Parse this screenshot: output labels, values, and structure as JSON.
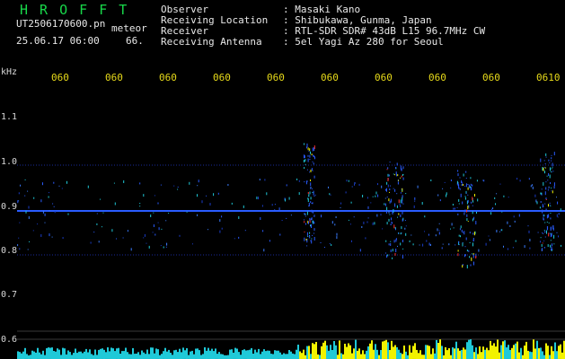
{
  "header": {
    "title": "H R O F F T",
    "filename": "UT2506170600.pn",
    "meteor_label": "meteor",
    "datetime": "25.06.17 06:00",
    "count": "66."
  },
  "info": [
    {
      "key": "Observer",
      "value": ": Masaki Kano"
    },
    {
      "key": "Receiving Location",
      "value": ": Shibukawa, Gunma, Japan"
    },
    {
      "key": "Receiver",
      "value": ": RTL-SDR SDR# 43dB L15 96.7MHz CW"
    },
    {
      "key": "Receiving Antenna",
      "value": ": 5el Yagi Az 280 for Seoul"
    }
  ],
  "axis": {
    "unit": "kHz",
    "y_labels": [
      "1.1",
      "1.0",
      "0.9",
      "0.8",
      "0.7",
      "0.6"
    ],
    "time_labels": [
      "060",
      "060",
      "060",
      "060",
      "060",
      "060",
      "060",
      "060",
      "060",
      "0610"
    ]
  },
  "colors": {
    "background": "#000000",
    "title_green": "#18d84a",
    "time_yellow": "#e6d91a",
    "text": "#e8e8e8",
    "carrier_blue": "#2a5cff",
    "noise_cyan": "#1fc9d8",
    "noise_yellow": "#f2f200"
  }
}
